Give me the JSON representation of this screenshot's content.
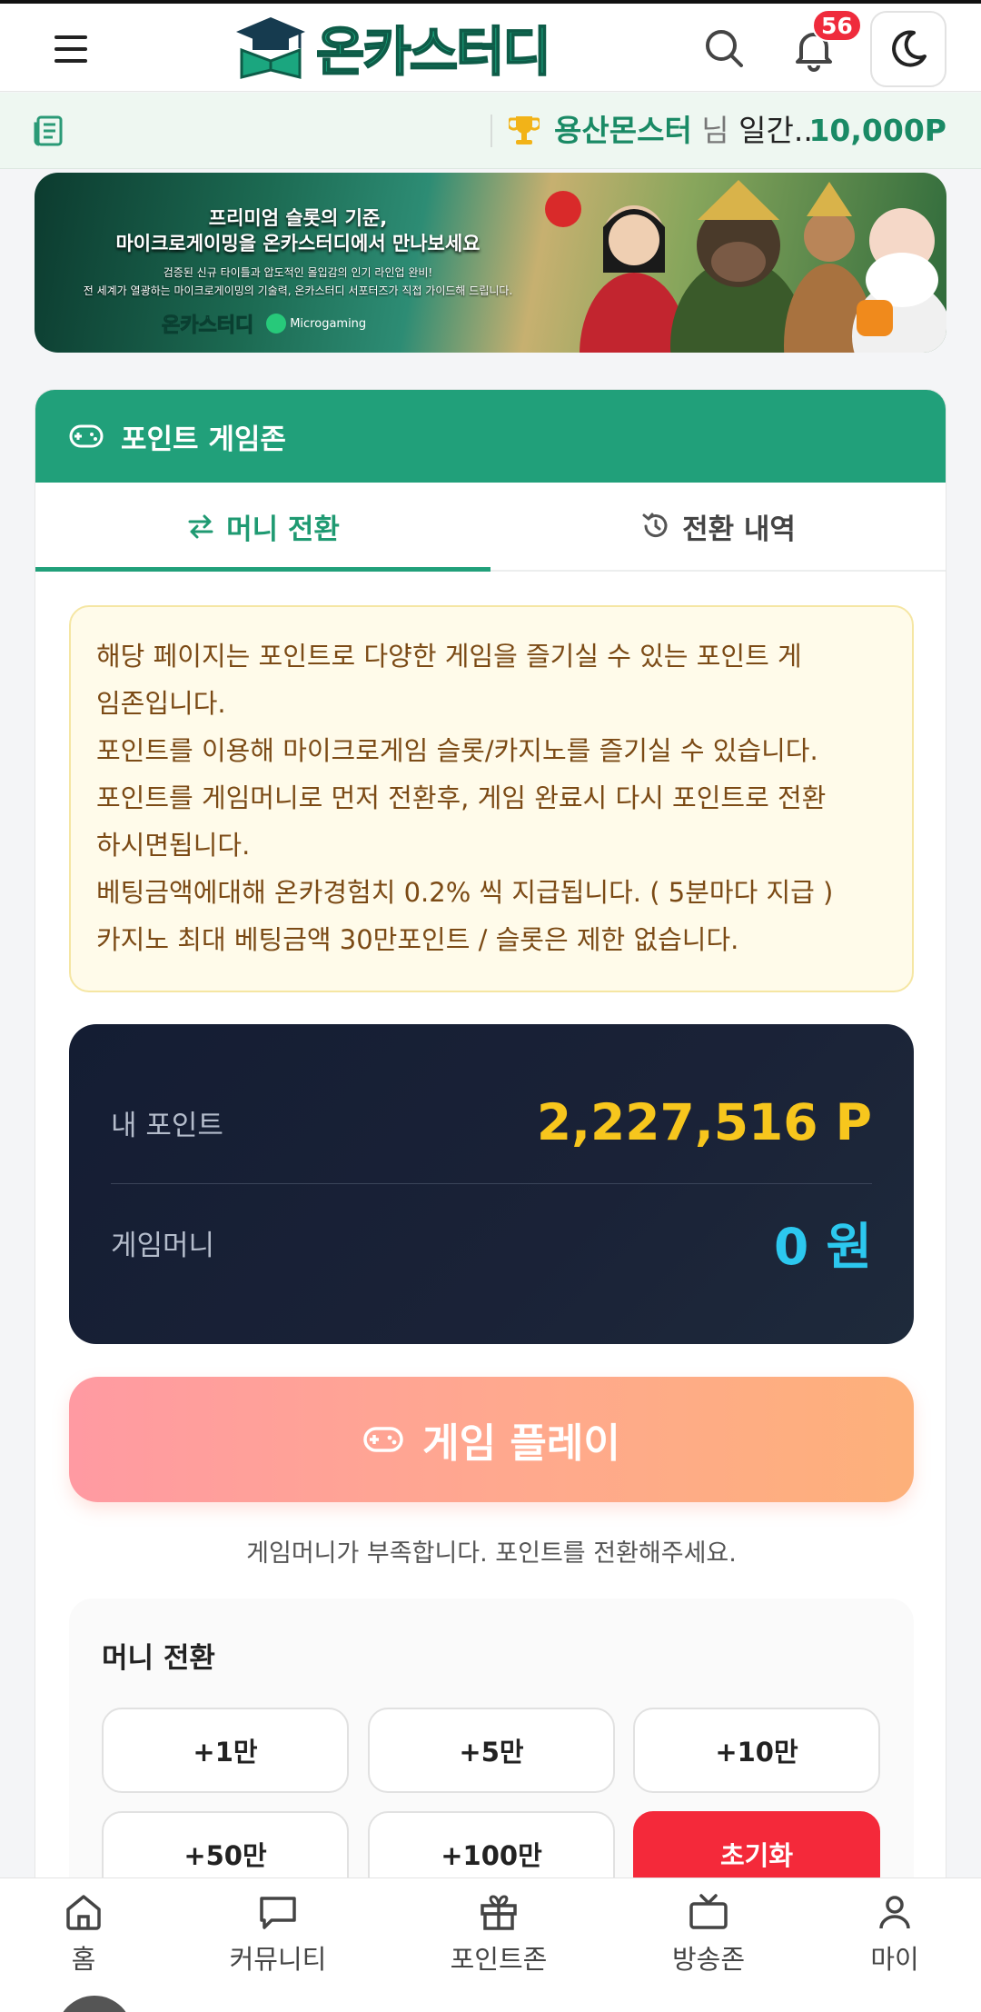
{
  "header": {
    "logo_text": "온카스터디",
    "notification_count": "56",
    "icons": [
      "menu-icon",
      "search-icon",
      "bell-icon",
      "moon-icon"
    ]
  },
  "ticker": {
    "name": "용산몬스터",
    "suffix": " 님",
    "rest": " 일간...",
    "amount": "10,000P"
  },
  "banner": {
    "line1": "프리미엄 슬롯의 기준,",
    "line2": "마이크로게이밍을 온카스터디에서 만나보세요",
    "line3": "검증된 신규 타이틀과 압도적인 몰입감의 인기 라인업 완비!",
    "line4": "전 세계가 열광하는 마이크로게이밍의 기술력, 온카스터디 서포터즈가 직접 가이드해 드립니다.",
    "brand": "온카스터디",
    "partner": "Microgaming"
  },
  "card": {
    "title": "포인트 게임존",
    "tabs": [
      {
        "label": "머니 전환",
        "active": true
      },
      {
        "label": "전환 내역",
        "active": false
      }
    ],
    "notice": [
      "해당 페이지는 포인트로 다양한 게임을 즐기실 수 있는 포인트 게",
      "임존입니다.",
      "포인트를 이용해 마이크로게임 슬롯/카지노를 즐기실 수 있습니다.",
      "포인트를 게임머니로 먼저 전환후, 게임 완료시 다시 포인트로 전환",
      "하시면됩니다.",
      "베팅금액에대해 온카경험치 0.2% 씩 지급됩니다. ( 5분마다 지급 )",
      "카지노 최대 베팅금액 30만포인트 / 슬롯은 제한 없습니다."
    ],
    "my_points_label": "내 포인트",
    "my_points_value": "2,227,516 P",
    "game_money_label": "게임머니",
    "game_money_value": "0 원",
    "play_label": "게임 플레이",
    "play_hint": "게임머니가 부족합니다. 포인트를 전환해주세요.",
    "money_title": "머니 전환",
    "amount_buttons": [
      "+1만",
      "+5만",
      "+10만",
      "+50만",
      "+100만",
      "초기화"
    ]
  },
  "bottom_nav": [
    "홈",
    "커뮤니티",
    "포인트존",
    "방송존",
    "마이"
  ],
  "colors": {
    "brand_green": "#21a07a",
    "points_yellow": "#f7c61d",
    "money_cyan": "#2cc8ef",
    "reset_red": "#f4293a"
  }
}
